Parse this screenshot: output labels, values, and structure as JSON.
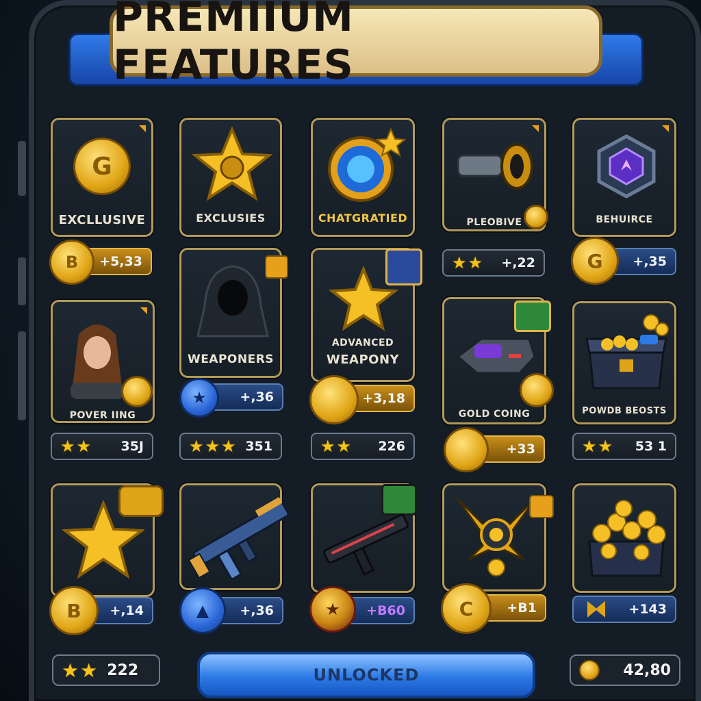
{
  "header": {
    "title": "PREMIIUM FEATURES"
  },
  "colors": {
    "gold": "#f2c744",
    "blue": "#2f7ae8",
    "frame": "#b39a5a",
    "banner": "#f0dfa6"
  },
  "row1": [
    {
      "label": "EXCLLUSIVE",
      "icon": "gold-coin-icon",
      "coin_letter": "G",
      "badge_coin": "B",
      "badge_value": "+5,33"
    },
    {
      "label": "EXCLUSIES",
      "icon": "gold-star-icon"
    },
    {
      "label": "CHATGRATIED",
      "icon": "blue-portal-icon"
    },
    {
      "label": "PLEOBIVE",
      "icon": "cannon-icon",
      "stars": "★★",
      "value": "+,22"
    },
    {
      "label": "BEHUIRCE",
      "icon": "purple-gem-icon",
      "badge_coin": "G",
      "badge_value": "+,35"
    }
  ],
  "row2": [
    {
      "label": "POVER IING",
      "icon": "girl-avatar-icon",
      "stars": "★★",
      "value": "35J"
    },
    {
      "label": "WEAPONERS",
      "icon": "hooded-figure-icon",
      "stars": "★★★",
      "value": "351",
      "badge_value": "+,36"
    },
    {
      "label_top": "ADVANCED",
      "label": "WEAPONY",
      "icon": "gold-star-icon",
      "stars": "★★",
      "value": "226",
      "badge_value": "+3,18"
    },
    {
      "label": "GOLD COING",
      "icon": "blaster-icon",
      "badge_value": "+33"
    },
    {
      "label": "POWDB BEOSTS",
      "icon": "treasure-chest-icon",
      "stars": "★★",
      "value": "53 1"
    }
  ],
  "row3": [
    {
      "icon": "gold-star-icon",
      "coin_letter": "B",
      "badge_value": "+,14"
    },
    {
      "icon": "assault-rifle-icon",
      "badge_value": "+,36"
    },
    {
      "icon": "smg-icon",
      "badge_value": "+B60"
    },
    {
      "icon": "crossed-blades-icon",
      "coin_letter": "C",
      "badge_value": "+B1"
    },
    {
      "icon": "coin-pile-icon",
      "badge_value": "+143"
    }
  ],
  "footer": {
    "stars": "★★",
    "left_value": "222",
    "button": "UNLOCKED",
    "right_value": "42,80"
  }
}
